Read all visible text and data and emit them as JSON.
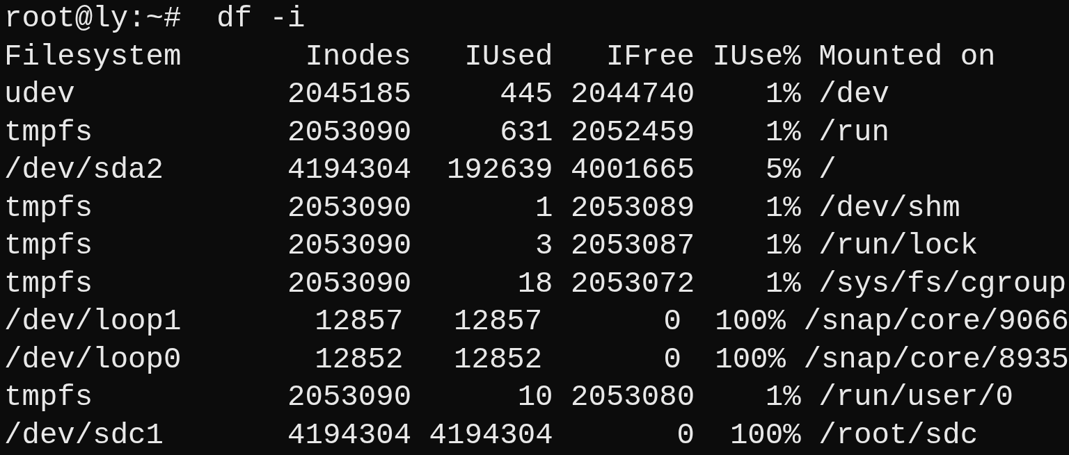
{
  "prompt": "root@ly:~#",
  "command": "df -i",
  "table": {
    "columns": [
      "Filesystem",
      "Inodes",
      "IUsed",
      "IFree",
      "IUse%",
      "Mounted on"
    ],
    "rows": [
      [
        "udev",
        "2045185",
        "445",
        "2044740",
        "1%",
        "/dev"
      ],
      [
        "tmpfs",
        "2053090",
        "631",
        "2052459",
        "1%",
        "/run"
      ],
      [
        "/dev/sda2",
        "4194304",
        "192639",
        "4001665",
        "5%",
        "/"
      ],
      [
        "tmpfs",
        "2053090",
        "1",
        "2053089",
        "1%",
        "/dev/shm"
      ],
      [
        "tmpfs",
        "2053090",
        "3",
        "2053087",
        "1%",
        "/run/lock"
      ],
      [
        "tmpfs",
        "2053090",
        "18",
        "2053072",
        "1%",
        "/sys/fs/cgroup"
      ],
      [
        "/dev/loop1",
        "12857",
        "12857",
        "0",
        "100%",
        "/snap/core/9066"
      ],
      [
        "/dev/loop0",
        "12852",
        "12852",
        "0",
        "100%",
        "/snap/core/8935"
      ],
      [
        "tmpfs",
        "2053090",
        "10",
        "2053080",
        "1%",
        "/run/user/0"
      ],
      [
        "/dev/sdc1",
        "4194304",
        "4194304",
        "0",
        "100%",
        "/root/sdc"
      ]
    ]
  }
}
